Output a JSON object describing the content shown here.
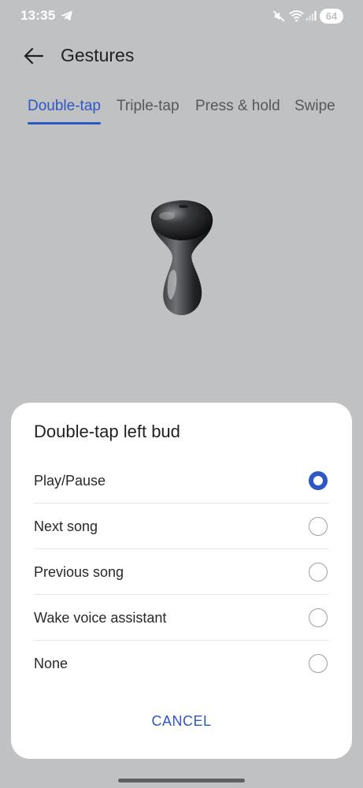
{
  "status_bar": {
    "time": "13:35",
    "battery": "64",
    "icons": [
      "telegram-icon",
      "mute-icon",
      "wifi-icon",
      "signal-icon"
    ]
  },
  "header": {
    "title": "Gestures",
    "back_icon": "arrow-left-icon"
  },
  "tabs": [
    {
      "label": "Double-tap",
      "active": true
    },
    {
      "label": "Triple-tap",
      "active": false
    },
    {
      "label": "Press & hold",
      "active": false
    },
    {
      "label": "Swipe",
      "active": false
    }
  ],
  "dialog": {
    "title": "Double-tap left bud",
    "options": [
      {
        "label": "Play/Pause",
        "selected": true
      },
      {
        "label": "Next song",
        "selected": false
      },
      {
        "label": "Previous song",
        "selected": false
      },
      {
        "label": "Wake voice assistant",
        "selected": false
      },
      {
        "label": "None",
        "selected": false
      }
    ],
    "cancel_label": "CANCEL"
  },
  "colors": {
    "accent": "#2e57c6",
    "background": "#bfc1c2",
    "dialog_background": "#ffffff"
  }
}
